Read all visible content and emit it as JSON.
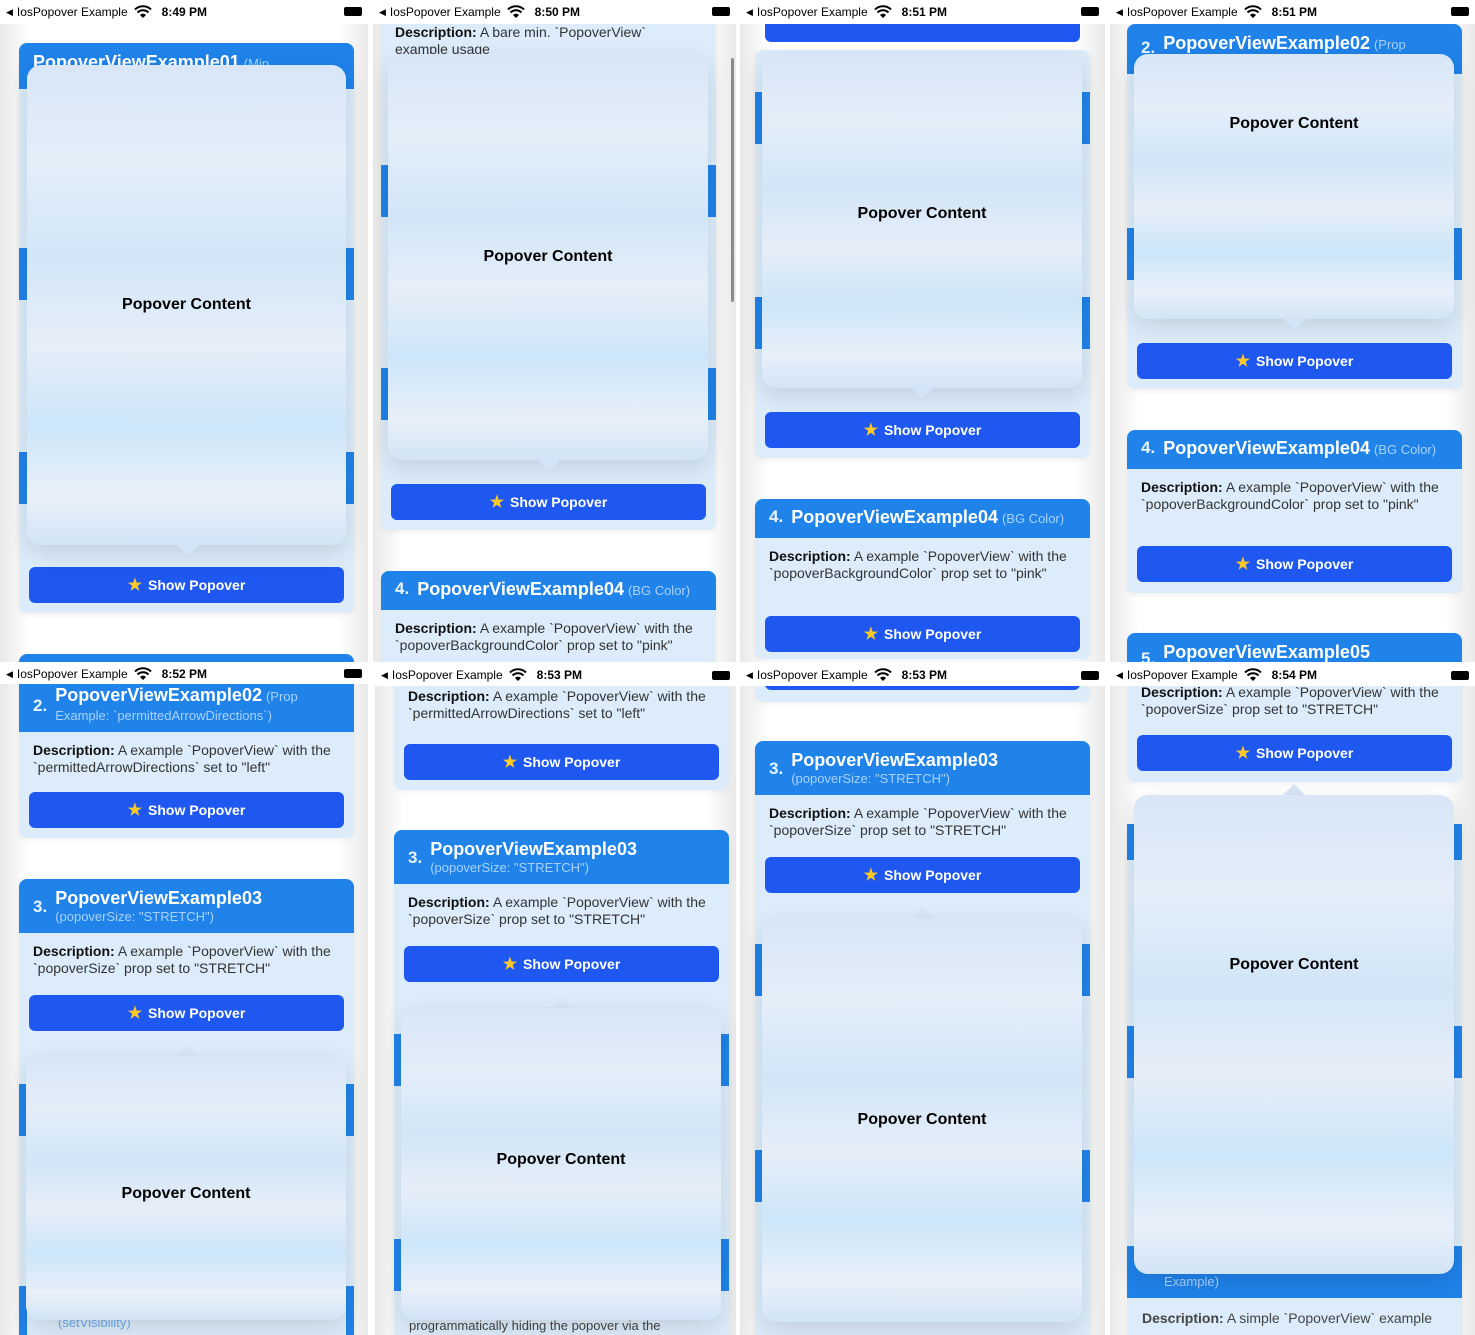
{
  "common": {
    "app_name": "IosPopover Example",
    "show_popover_label": "Show Popover",
    "popover_content": "Popover Content",
    "desc_label": "Description:"
  },
  "screens": [
    {
      "time": "8:49 PM"
    },
    {
      "time": "8:50 PM"
    },
    {
      "time": "8:51 PM"
    },
    {
      "time": "8:51 PM"
    },
    {
      "time": "8:52 PM"
    },
    {
      "time": "8:53 PM"
    },
    {
      "time": "8:53 PM"
    },
    {
      "time": "8:54 PM"
    }
  ],
  "examples": {
    "ex01": {
      "title": "PopoverViewExample01",
      "sub": "(Min",
      "desc": "A bare min. `PopoverView` example usage"
    },
    "ex02": {
      "num": "2.",
      "title": "PopoverViewExample02",
      "sub_short": "(Prop",
      "sub": "(Prop Example: `permittedArrowDirections`)",
      "desc": "A example `PopoverView` with the `permittedArrowDirections` set to \"left\""
    },
    "ex03": {
      "num": "3.",
      "title": "PopoverViewExample03",
      "sub": "(popoverSize: \"STRETCH\")",
      "desc": "A example `PopoverView` with the `popoverSize` prop set to \"STRETCH\""
    },
    "ex04": {
      "num": "4.",
      "title": "PopoverViewExample04",
      "sub": "(BG Color)",
      "desc": "A example `PopoverView` with the `popoverBackgroundColor` prop set to \"pink\""
    },
    "ex05": {
      "num": "5.",
      "title": "PopoverViewExample05"
    }
  },
  "fragments": {
    "desc_bare_min": "A bare min. `PopoverView` example usage",
    "example_close": "Example)",
    "set_visibility": "(setVisibility)",
    "programmatic": "programmatically hiding the popover via the",
    "simple_example": "A simple `PopoverView` example",
    "ex02_sub_line1": "(Prop",
    "ex02_sub_line2": "Example: `permittedArrowDirections`)"
  },
  "colors": {
    "card_header": "#1f83ea",
    "card_body": "#dcecfa",
    "button": "#1e58f0",
    "star": "#ffc928"
  }
}
